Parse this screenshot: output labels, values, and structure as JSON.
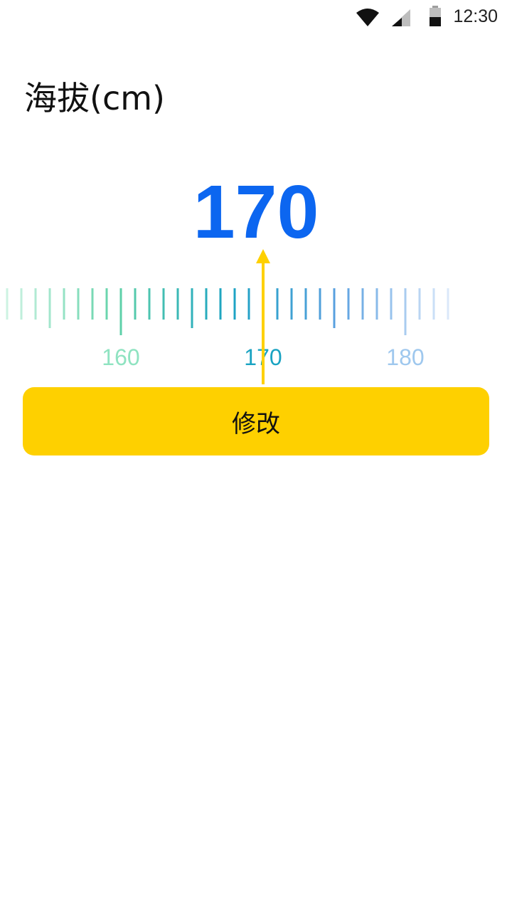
{
  "status_bar": {
    "time": "12:30",
    "icons": [
      "wifi-icon",
      "cellular-signal-icon",
      "battery-icon"
    ]
  },
  "page": {
    "title": "海拔(cm)",
    "value": "170"
  },
  "ruler": {
    "min": 152,
    "max": 183,
    "step": 1,
    "current": 170,
    "labels": [
      160,
      170,
      180
    ],
    "pointer_color": "#fed000",
    "gradient_colors": [
      "#cdf3e2",
      "#60d2a8",
      "#1aa3c2",
      "#5aa0e0",
      "#dbe8fa"
    ],
    "label_colors": {
      "160": "#8fe3c1",
      "170": "#1aa3c2",
      "180": "#9fc8ee"
    }
  },
  "button": {
    "label": "修改",
    "color": "#fed000"
  },
  "colors": {
    "value": "#0c66f0",
    "background": "#ffffff"
  }
}
